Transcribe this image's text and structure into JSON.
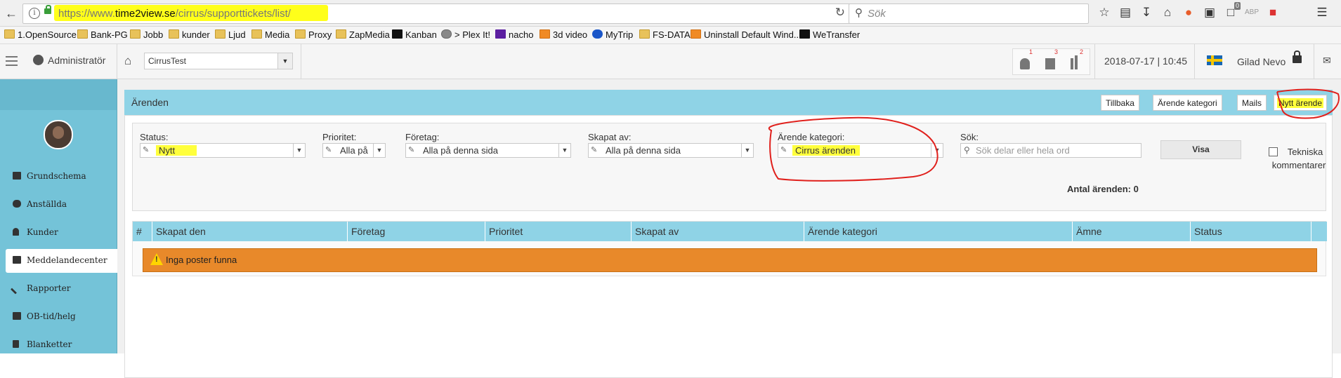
{
  "browser": {
    "url_prefix": "https://www.",
    "url_domain": "time2view.se",
    "url_path": "/cirrus/supporttickets/list/",
    "search_placeholder": "Sök",
    "bookmarks": [
      "1.OpenSource",
      "Bank-PG",
      "Jobb",
      "kunder",
      "Ljud",
      "Media",
      "Proxy",
      "ZapMedia",
      "Kanban",
      "> Plex It!",
      "nacho",
      "3d video",
      "MyTrip",
      "FS-DATA",
      "Uninstall Default Wind...",
      "WeTransfer"
    ],
    "badge_count": "0"
  },
  "topbar": {
    "role": "Administratör",
    "client": "CirrusTest",
    "counters": [
      "1",
      "3",
      "2"
    ],
    "datetime": "2018-07-17 | 10:45",
    "user": "Gilad Nevo"
  },
  "sidebar": {
    "items": [
      {
        "label": "Grundschema",
        "icon": "calendar-icon"
      },
      {
        "label": "Anställda",
        "icon": "users-icon"
      },
      {
        "label": "Kunder",
        "icon": "user-icon"
      },
      {
        "label": "Meddelandecenter",
        "icon": "envelope-icon"
      },
      {
        "label": "Rapporter",
        "icon": "pencil-icon"
      },
      {
        "label": "OB-tid/helg",
        "icon": "calendar-icon"
      },
      {
        "label": "Blanketter",
        "icon": "document-icon"
      }
    ],
    "active_index": 3
  },
  "panel": {
    "title": "Ärenden",
    "buttons": {
      "back": "Tillbaka",
      "category": "Ärende kategori",
      "mails": "Mails",
      "new": "Nytt ärende"
    }
  },
  "filters": {
    "status": {
      "label": "Status:",
      "value": "Nytt"
    },
    "priority": {
      "label": "Prioritet:",
      "value": "Alla på"
    },
    "company": {
      "label": "Företag:",
      "value": "Alla på denna sida"
    },
    "created_by": {
      "label": "Skapat av:",
      "value": "Alla på denna sida"
    },
    "category": {
      "label": "Ärende kategori:",
      "value": "Cirrus ärenden"
    },
    "search": {
      "label": "Sök:",
      "placeholder": "Sök delar eller hela ord"
    },
    "show_button": "Visa",
    "tech_comments": "Tekniska kommentarer",
    "count": "Antal ärenden: 0"
  },
  "table": {
    "columns": [
      "#",
      "Skapat den",
      "Företag",
      "Prioritet",
      "Skapat av",
      "Ärende kategori",
      "Ämne",
      "Status"
    ],
    "empty_message": "Inga poster funna"
  },
  "colors": {
    "header_blue": "#8fd3e6",
    "sidebar_blue": "#74c3d8",
    "alert_orange": "#e8892a",
    "highlight_yellow": "#ffff3c",
    "annotation_red": "#e0201c"
  }
}
